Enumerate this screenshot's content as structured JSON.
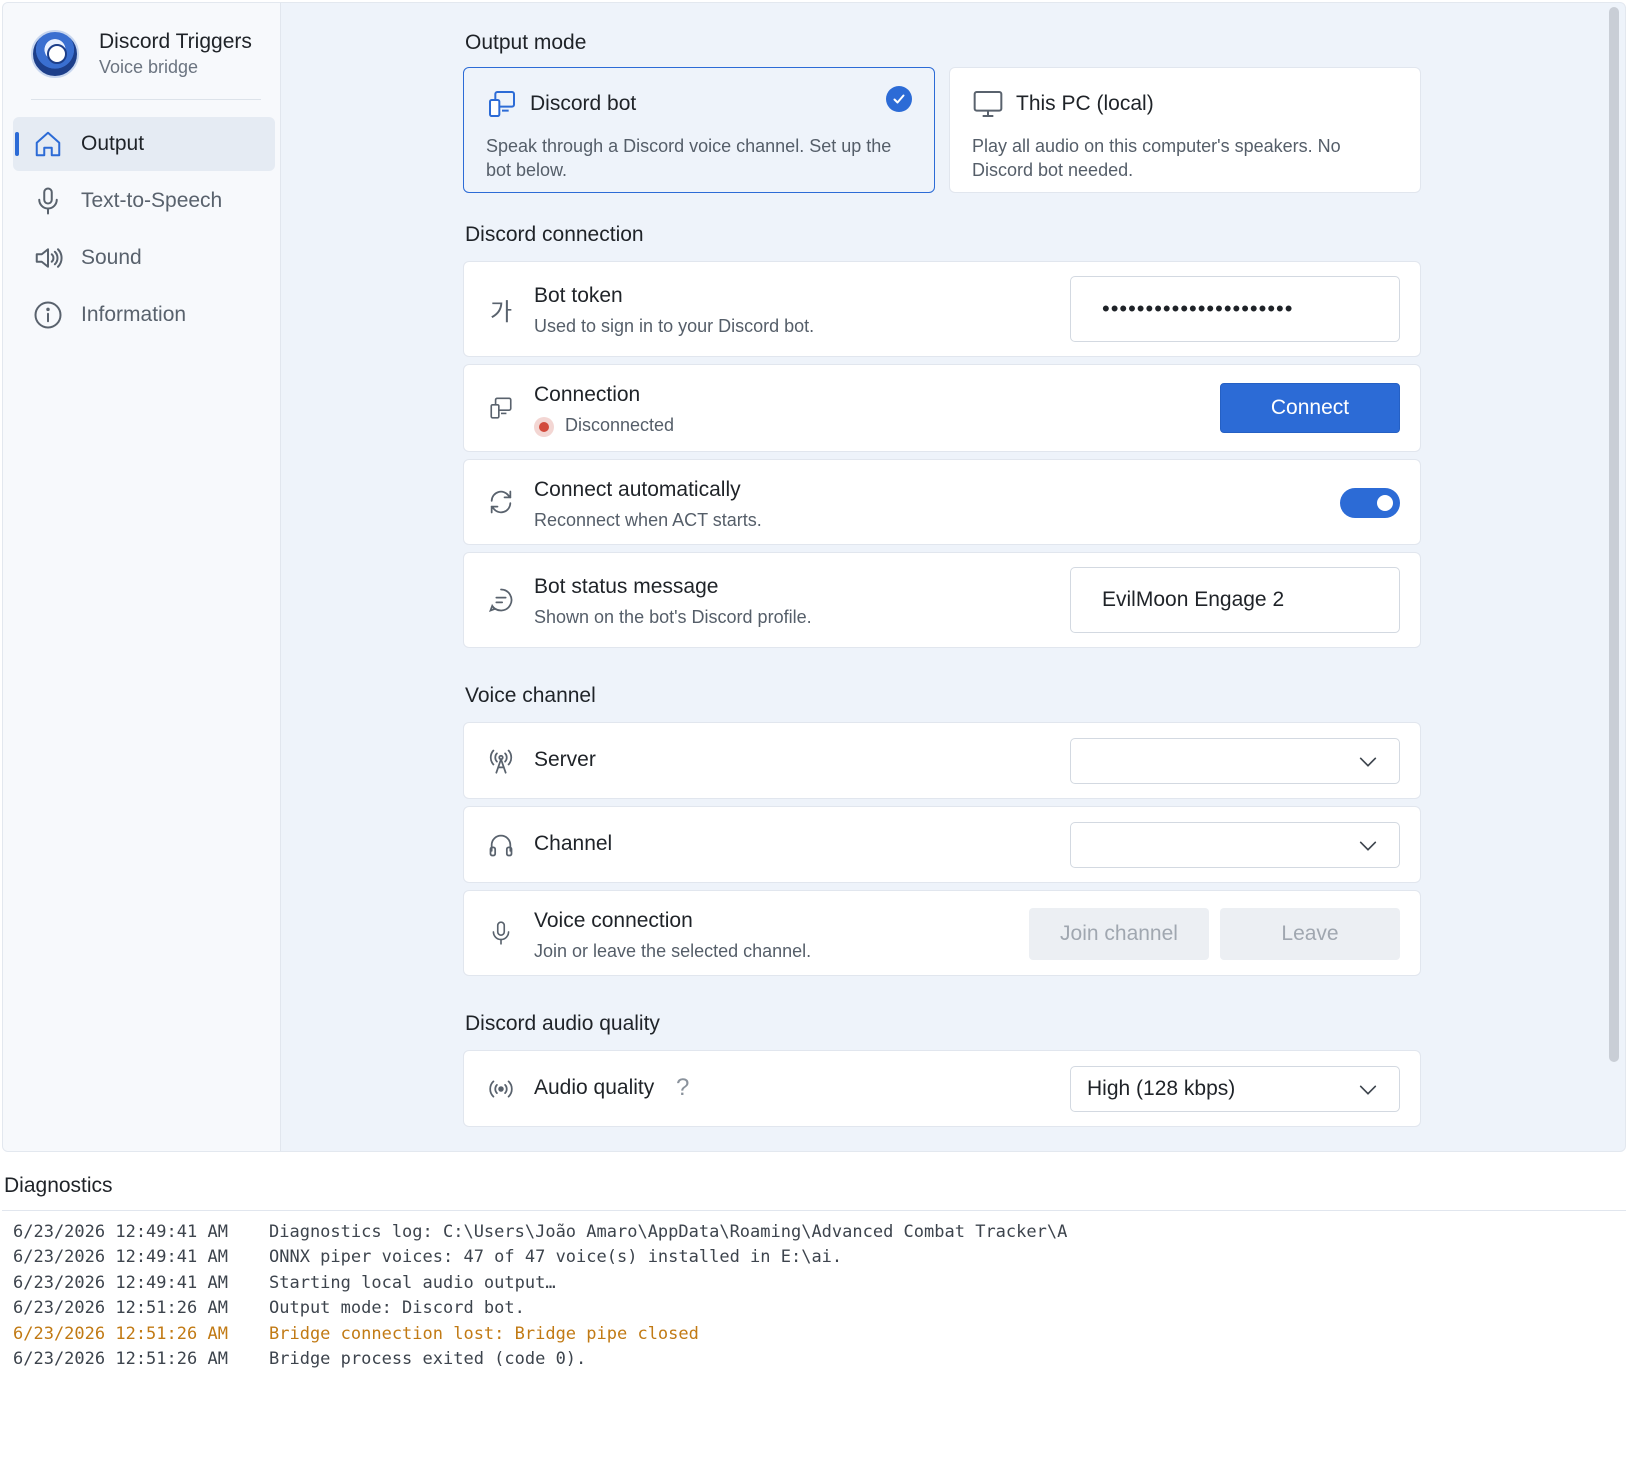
{
  "brand": {
    "title": "Discord Triggers",
    "subtitle": "Voice bridge"
  },
  "nav": [
    {
      "label": "Output",
      "icon": "home-icon",
      "active": true
    },
    {
      "label": "Text-to-Speech",
      "icon": "microphone-icon",
      "active": false
    },
    {
      "label": "Sound",
      "icon": "speaker-icon",
      "active": false
    },
    {
      "label": "Information",
      "icon": "info-icon",
      "active": false
    }
  ],
  "output_mode": {
    "heading": "Output mode",
    "options": [
      {
        "title": "Discord bot",
        "desc": "Speak through a Discord voice channel. Set up the bot below.",
        "selected": true,
        "icon": "bot-devices-icon"
      },
      {
        "title": "This PC (local)",
        "desc": "Play all audio on this computer's speakers. No Discord bot needed.",
        "selected": false,
        "icon": "monitor-icon"
      }
    ]
  },
  "discord_connection": {
    "heading": "Discord connection",
    "bot_token": {
      "title": "Bot token",
      "sub": "Used to sign in to your Discord bot.",
      "value": "••••••••••••••••••••••",
      "icon": "korean-character-icon",
      "icon_glyph": "가"
    },
    "connection": {
      "title": "Connection",
      "status": "Disconnected",
      "button": "Connect",
      "icon": "bot-devices-icon"
    },
    "auto_connect": {
      "title": "Connect automatically",
      "sub": "Reconnect when ACT starts.",
      "enabled": true,
      "icon": "refresh-icon"
    },
    "status_message": {
      "title": "Bot status message",
      "sub": "Shown on the bot's Discord profile.",
      "value": "EvilMoon Engage 2",
      "icon": "chat-bubble-icon"
    }
  },
  "voice_channel": {
    "heading": "Voice channel",
    "server": {
      "title": "Server",
      "value": "",
      "icon": "antenna-icon"
    },
    "channel": {
      "title": "Channel",
      "value": "",
      "icon": "headphones-icon"
    },
    "voice_connection": {
      "title": "Voice connection",
      "sub": "Join or leave the selected channel.",
      "join_label": "Join channel",
      "leave_label": "Leave",
      "icon": "microphone-icon"
    }
  },
  "audio_quality": {
    "heading": "Discord audio quality",
    "title": "Audio quality",
    "help": "?",
    "value": "High (128 kbps)",
    "icon": "broadcast-icon"
  },
  "diagnostics": {
    "heading": "Diagnostics",
    "lines": [
      {
        "ts": "6/23/2026 12:49:41 AM",
        "msg": "Diagnostics log: C:\\Users\\João Amaro\\AppData\\Roaming\\Advanced Combat Tracker\\A",
        "level": "info"
      },
      {
        "ts": "6/23/2026 12:49:41 AM",
        "msg": "ONNX piper voices: 47 of 47 voice(s) installed in E:\\ai.",
        "level": "info"
      },
      {
        "ts": "6/23/2026 12:49:41 AM",
        "msg": "Starting local audio output…",
        "level": "info"
      },
      {
        "ts": "6/23/2026 12:51:26 AM",
        "msg": "Output mode: Discord bot.",
        "level": "info"
      },
      {
        "ts": "6/23/2026 12:51:26 AM",
        "msg": "Bridge connection lost: Bridge pipe closed",
        "level": "warn"
      },
      {
        "ts": "6/23/2026 12:51:26 AM",
        "msg": "Bridge process exited (code 0).",
        "level": "info"
      }
    ]
  },
  "colors": {
    "accent": "#2c6bd6",
    "warn": "#c17a14",
    "error_dot": "#d24a3c"
  }
}
